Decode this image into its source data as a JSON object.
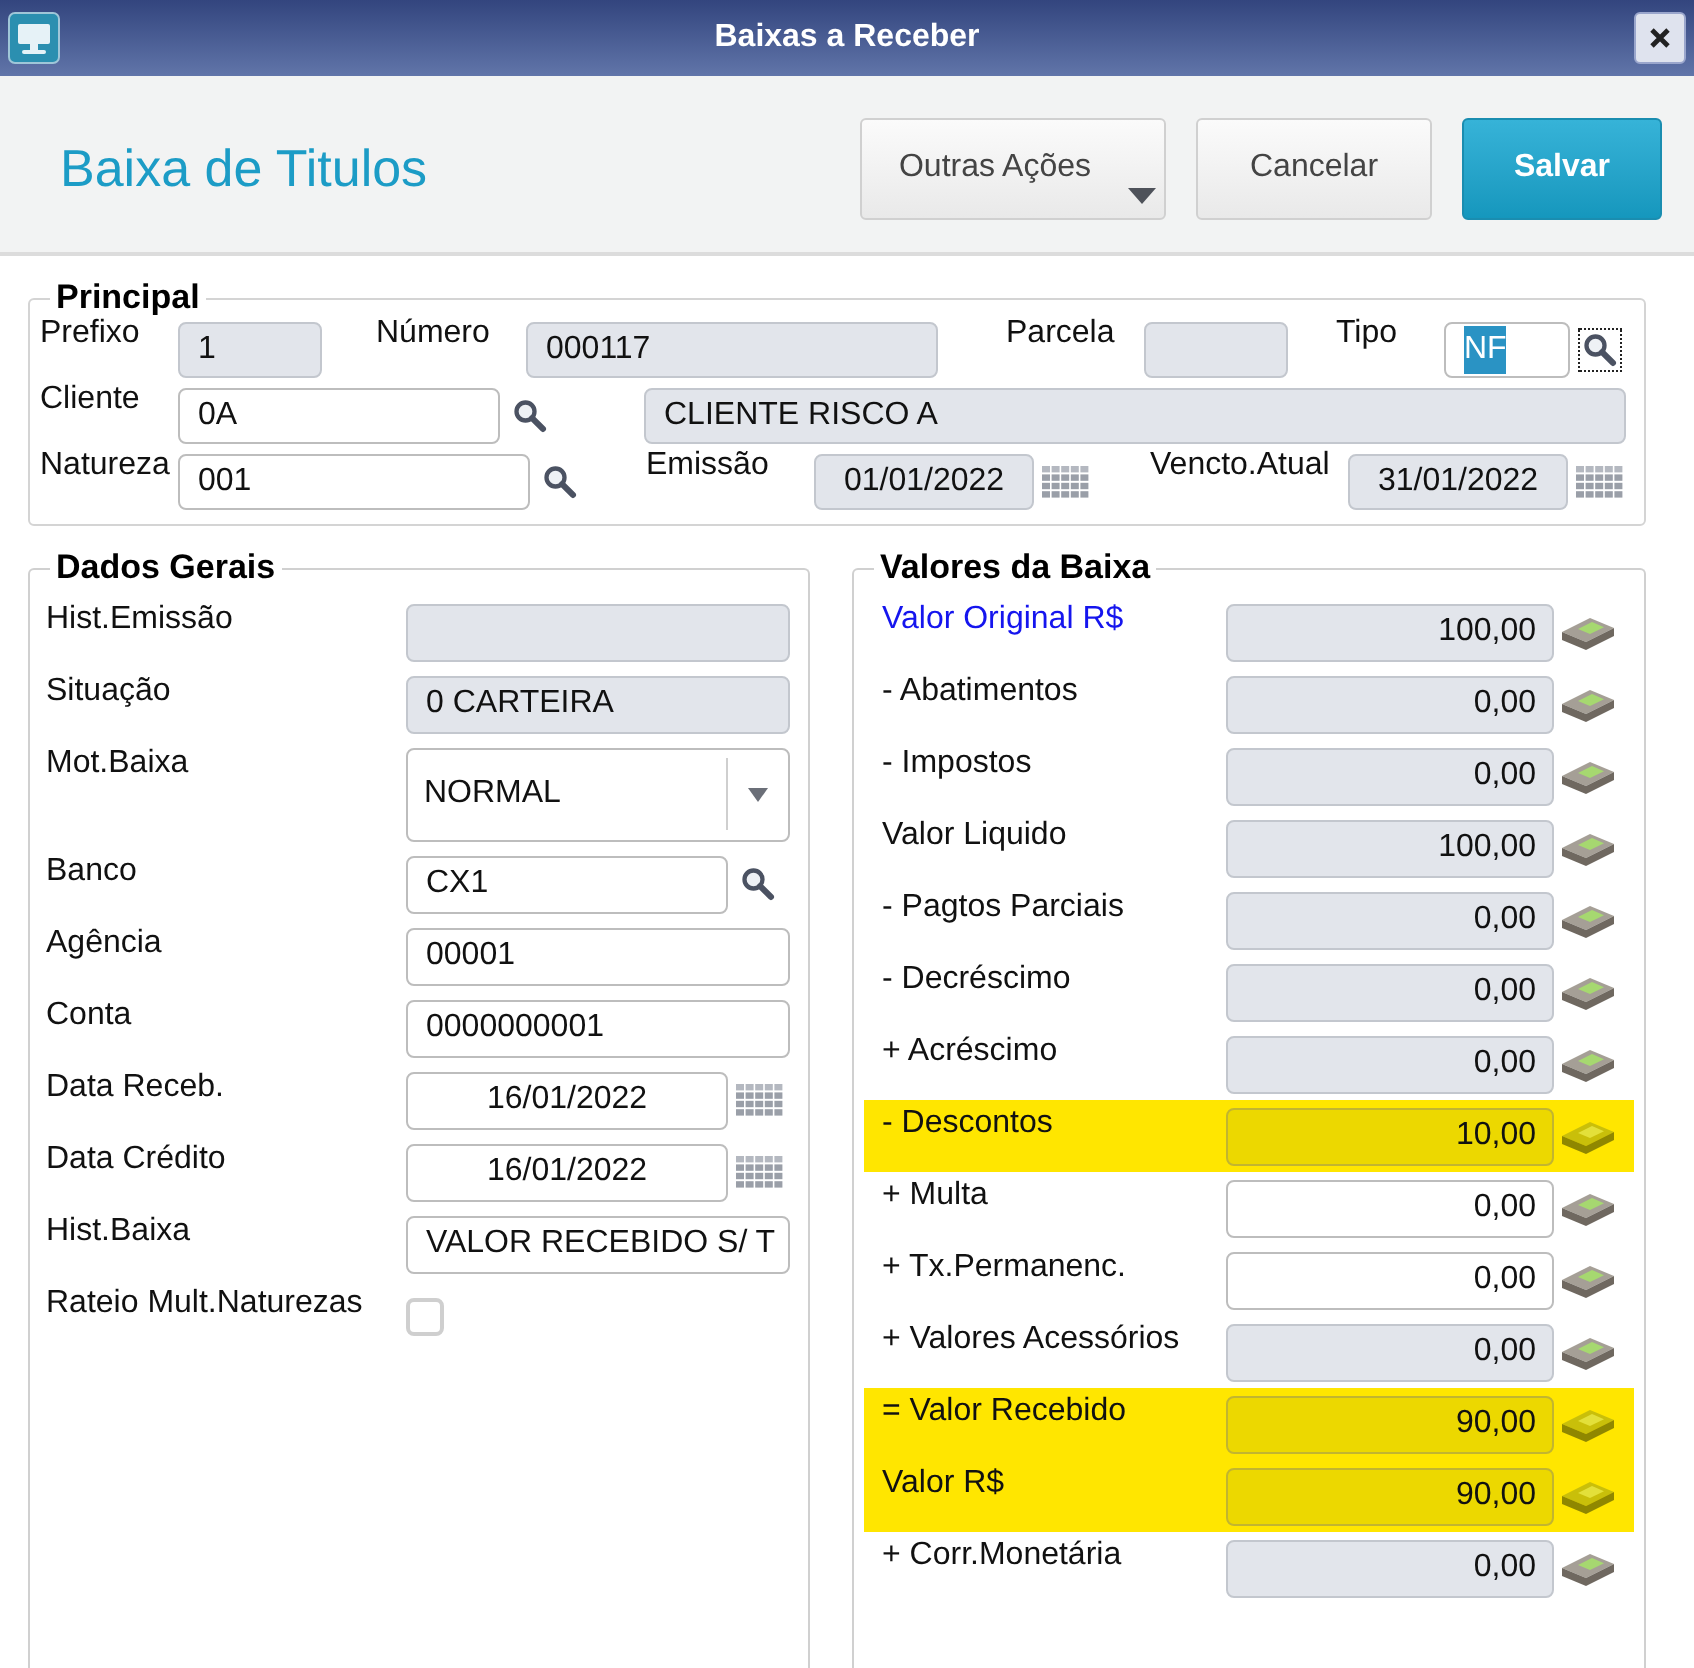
{
  "window": {
    "title": "Baixas a Receber"
  },
  "header": {
    "title": "Baixa de Titulos",
    "buttons": [
      {
        "label": "Outras Ações",
        "kind": "menu"
      },
      {
        "label": "Cancelar",
        "kind": "secondary"
      },
      {
        "label": "Salvar",
        "kind": "primary"
      }
    ]
  },
  "principal": {
    "legend": "Principal",
    "rows": [
      {
        "fields": [
          {
            "label": "Prefixo",
            "value": "1",
            "kind": "text",
            "disabled": true,
            "focused": false
          },
          {
            "label": "Número",
            "value": "000117",
            "kind": "text",
            "disabled": true,
            "focused": false
          },
          {
            "label": "Parcela",
            "kind": "text",
            "disabled": true,
            "focused": false
          },
          {
            "label": "Tipo",
            "value": "NF",
            "kind": "lookup",
            "disabled": false,
            "focused": true
          }
        ]
      },
      {
        "fields": [
          {
            "label": "Cliente",
            "value": "0A",
            "kind": "lookup",
            "disabled": false,
            "focused": false
          },
          {
            "value": "CLIENTE RISCO A",
            "kind": "text",
            "disabled": true,
            "focused": false
          }
        ]
      },
      {
        "fields": [
          {
            "label": "Natureza",
            "value": "001",
            "kind": "lookup",
            "disabled": false,
            "focused": false
          },
          {
            "label": "Emissão",
            "value": "01/01/2022",
            "kind": "date",
            "disabled": true,
            "focused": false
          },
          {
            "label": "Vencto.Atual",
            "value": "31/01/2022",
            "kind": "date",
            "disabled": true,
            "focused": false
          }
        ]
      }
    ]
  },
  "dados_gerais": {
    "legend": "Dados Gerais",
    "fields": [
      {
        "label": "Hist.Emissão",
        "kind": "text",
        "disabled": true
      },
      {
        "label": "Situação",
        "value": "0 CARTEIRA",
        "kind": "text",
        "disabled": true
      },
      {
        "label": "Mot.Baixa",
        "value": "NORMAL",
        "kind": "select",
        "disabled": false
      },
      {
        "label": "Banco",
        "value": "CX1",
        "kind": "lookup",
        "disabled": false
      },
      {
        "label": "Agência",
        "value": "00001",
        "kind": "text",
        "disabled": false
      },
      {
        "label": "Conta",
        "value": "0000000001",
        "kind": "text",
        "disabled": false
      },
      {
        "label": "Data Receb.",
        "value": "16/01/2022",
        "kind": "date",
        "disabled": false
      },
      {
        "label": "Data Crédito",
        "value": "16/01/2022",
        "kind": "date",
        "disabled": false
      },
      {
        "label": "Hist.Baixa",
        "value": "VALOR RECEBIDO S/ T",
        "kind": "text",
        "disabled": false
      },
      {
        "label": "Rateio Mult.Naturezas",
        "kind": "checkbox",
        "checked": false,
        "disabled": false
      }
    ]
  },
  "valores_da_baixa": {
    "legend": "Valores da Baixa",
    "rows": [
      {
        "label": "Valor Original R$",
        "value": "100,00",
        "link": true,
        "disabled": true,
        "highlighted": false
      },
      {
        "label": "- Abatimentos",
        "value": "0,00",
        "link": false,
        "disabled": true,
        "highlighted": false
      },
      {
        "label": "- Impostos",
        "value": "0,00",
        "link": false,
        "disabled": true,
        "highlighted": false
      },
      {
        "label": "Valor Liquido",
        "value": "100,00",
        "link": false,
        "disabled": true,
        "highlighted": false
      },
      {
        "label": "- Pagtos Parciais",
        "value": "0,00",
        "link": false,
        "disabled": true,
        "highlighted": false
      },
      {
        "label": "- Decréscimo",
        "value": "0,00",
        "link": false,
        "disabled": true,
        "highlighted": false
      },
      {
        "label": "+ Acréscimo",
        "value": "0,00",
        "link": false,
        "disabled": true,
        "highlighted": false
      },
      {
        "label": "- Descontos",
        "value": "10,00",
        "link": false,
        "disabled": true,
        "highlighted": true
      },
      {
        "label": "+ Multa",
        "value": "0,00",
        "link": false,
        "disabled": false,
        "highlighted": false
      },
      {
        "label": "+ Tx.Permanenc.",
        "value": "0,00",
        "link": false,
        "disabled": false,
        "highlighted": false
      },
      {
        "label": "+ Valores Acessórios",
        "value": "0,00",
        "link": false,
        "disabled": true,
        "highlighted": false
      },
      {
        "label": "= Valor Recebido",
        "value": "90,00",
        "link": false,
        "disabled": true,
        "highlighted": true
      },
      {
        "label": "Valor R$",
        "value": "90,00",
        "link": false,
        "disabled": true,
        "highlighted": true
      },
      {
        "label": "+ Corr.Monetária",
        "value": "0,00",
        "link": false,
        "disabled": true,
        "highlighted": false
      }
    ]
  }
}
